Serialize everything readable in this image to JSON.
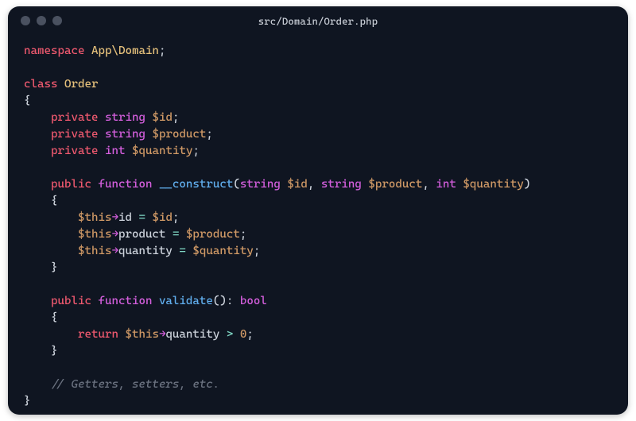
{
  "window": {
    "title": "src/Domain/Order.php"
  },
  "colors": {
    "background": "#0f1521",
    "traffic_light": "#4a5160",
    "title_text": "#c9ced6",
    "code_default": "#cdd3dc",
    "keyword_red": "#ef596f",
    "keyword_purple": "#d55fde",
    "class_yellow": "#e5c07b",
    "function_blue": "#61afef",
    "variable_orange": "#d19a66",
    "operator_teal": "#7fd6c4",
    "comment_gray": "#6b7280"
  },
  "tokens": {
    "kw_namespace": "namespace",
    "ns_name": "App\\Domain",
    "kw_class": "class",
    "class_name": "Order",
    "kw_private": "private",
    "kw_public": "public",
    "kw_function": "function",
    "kw_return": "return",
    "type_string": "string",
    "type_int": "int",
    "type_bool": "bool",
    "var_id": "$id",
    "var_product": "$product",
    "var_quantity": "$quantity",
    "var_this": "$this",
    "fn_construct": "__construct",
    "fn_validate": "validate",
    "prop_id": "id",
    "prop_product": "product",
    "prop_quantity": "quantity",
    "arrow": "→",
    "op_assign": "=",
    "op_gt": ">",
    "num_zero": "0",
    "semicolon": ";",
    "colon": ":",
    "lparen": "(",
    "rparen": ")",
    "lbrace": "{",
    "rbrace": "}",
    "comma": ",",
    "comment_getters": "// Getters, setters, etc."
  }
}
